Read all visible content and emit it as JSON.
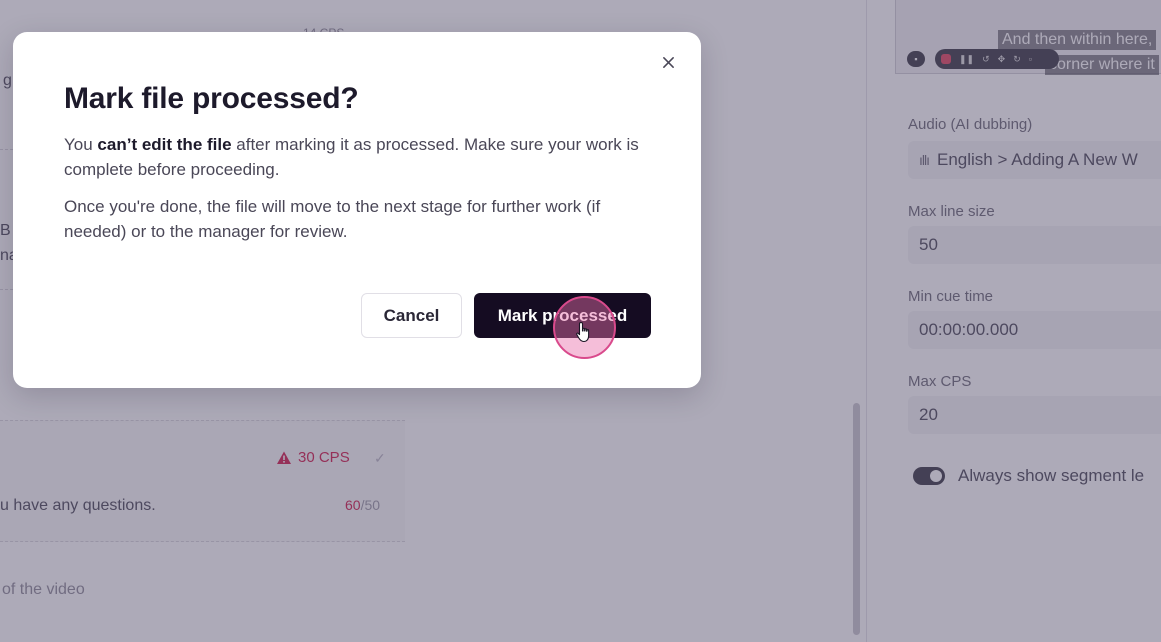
{
  "background": {
    "left_panel": {
      "top_small_text": "14 CPS",
      "edge_fragments": [
        "g",
        "B",
        "na"
      ],
      "segment_warning": {
        "badge": "30 CPS",
        "text": "u have any questions.",
        "char_over": "60",
        "char_limit": "/50"
      },
      "bottom_text": "of the video"
    },
    "video_preview": {
      "caption_line_1": "And then within here,",
      "caption_line_2": "corner where it"
    },
    "settings": {
      "audio_label": "Audio (AI dubbing)",
      "audio_value": "English > Adding A New W",
      "max_line_size_label": "Max line size",
      "max_line_size_value": "50",
      "min_cue_time_label": "Min cue time",
      "min_cue_time_value": "00:00:00.000",
      "max_cps_label": "Max CPS",
      "max_cps_value": "20",
      "toggle_label": "Always show segment le"
    }
  },
  "modal": {
    "title": "Mark file processed?",
    "p1_prefix": "You ",
    "p1_bold": "can’t edit the file",
    "p1_suffix": " after marking it as processed. Make sure your work is complete before proceeding.",
    "p2": "Once you're done, the file will move to the next stage for further work (if needed) or to the manager for review.",
    "cancel_label": "Cancel",
    "confirm_label": "Mark processed"
  },
  "colors": {
    "overlay": "#504a68",
    "primary_button": "#150c22",
    "warning": "#d11a4a",
    "click_ring": "#e86eaa"
  },
  "icons": {
    "close": "close-icon",
    "warning": "warning-triangle-icon",
    "check": "check-icon",
    "audio": "waveform-icon",
    "cursor": "hand-pointer-icon"
  }
}
